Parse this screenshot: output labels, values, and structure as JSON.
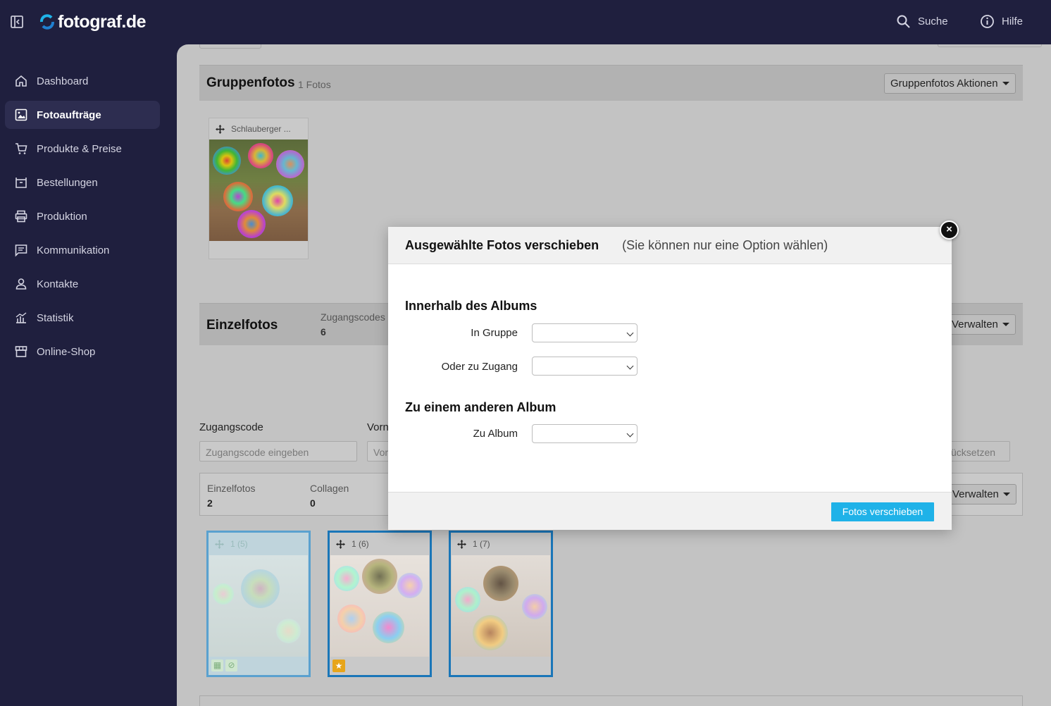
{
  "app": {
    "brand": "fotograf.de",
    "brand_color": "#1f1f3e",
    "accent_color": "#1fb2e8"
  },
  "topbar": {
    "search_label": "Suche",
    "help_label": "Hilfe"
  },
  "sidebar": {
    "items": [
      {
        "label": "Dashboard",
        "icon": "home-icon"
      },
      {
        "label": "Fotoaufträge",
        "icon": "image-icon",
        "active": true
      },
      {
        "label": "Produkte & Preise",
        "icon": "cart-icon"
      },
      {
        "label": "Bestellungen",
        "icon": "inbox-icon"
      },
      {
        "label": "Produktion",
        "icon": "printer-icon"
      },
      {
        "label": "Kommunikation",
        "icon": "message-icon"
      },
      {
        "label": "Kontakte",
        "icon": "person-icon"
      },
      {
        "label": "Statistik",
        "icon": "chart-icon"
      },
      {
        "label": "Online-Shop",
        "icon": "store-icon"
      }
    ]
  },
  "group_section": {
    "title": "Gruppenfotos",
    "count": "1 Fotos",
    "actions_label": "Gruppenfotos Aktionen",
    "card_name": "Schlauberger ..."
  },
  "einzel_section": {
    "title": "Einzelfotos",
    "access_label": "Zugangscodes",
    "access_value": "6",
    "manage_label": "Verwalten"
  },
  "filters": {
    "code_label": "Zugangscode",
    "code_placeholder": "Zugangscode eingeben",
    "firstname_label": "Vorn",
    "firstname_placeholder": "Vor",
    "reset_label": "ücksetzen"
  },
  "stats": {
    "einzelfotos_label": "Einzelfotos",
    "einzelfotos_value": "2",
    "collagen_label": "Collagen",
    "collagen_value": "0",
    "manage_label": "Verwalten"
  },
  "thumbs": [
    {
      "label": "1 (5)"
    },
    {
      "label": "1 (6)"
    },
    {
      "label": "1 (7)"
    }
  ],
  "modal": {
    "title": "Ausgewählte Fotos verschieben",
    "subtitle": "(Sie können nur eine Option wählen)",
    "close_symbol": "×",
    "section1_title": "Innerhalb des Albums",
    "in_group_label": "In Gruppe",
    "or_access_label": "Oder zu Zugang",
    "section2_title": "Zu einem anderen Album",
    "to_album_label": "Zu Album",
    "in_group_value": "",
    "or_access_value": "",
    "to_album_value": "",
    "submit_label": "Fotos verschieben"
  }
}
